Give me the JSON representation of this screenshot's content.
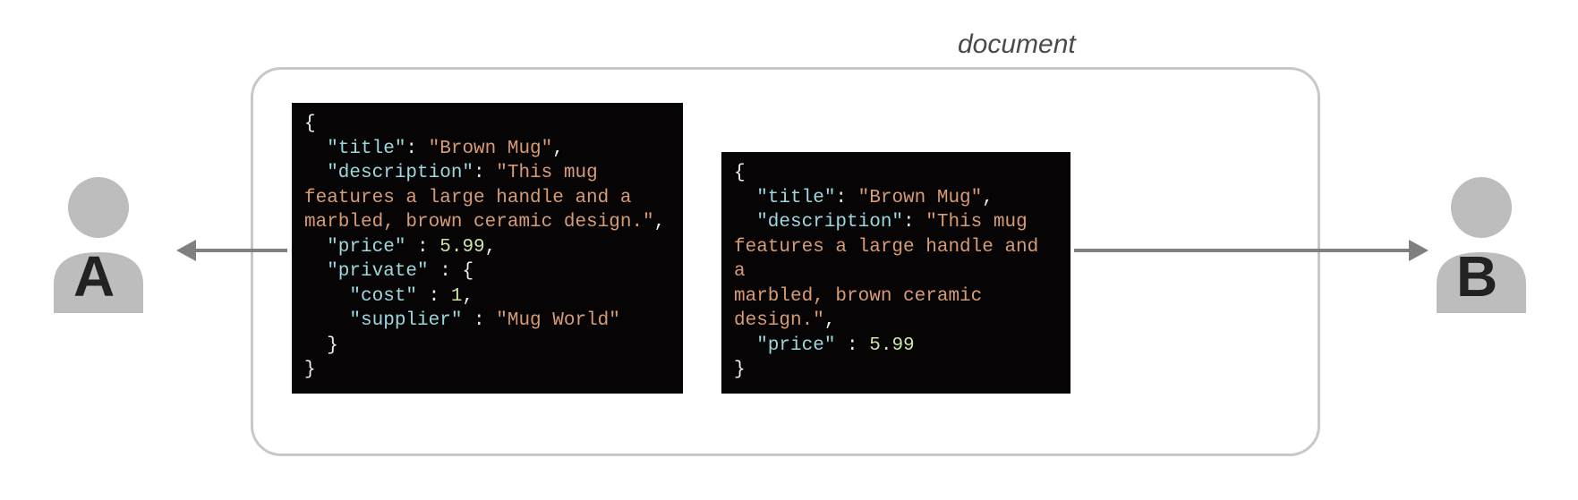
{
  "label": {
    "document": "document"
  },
  "users": {
    "a": "A",
    "b": "B"
  },
  "json": {
    "k_title": "\"title\"",
    "k_description": "\"description\"",
    "k_price": "\"price\"",
    "k_private": "\"private\"",
    "k_cost": "\"cost\"",
    "k_supplier": "\"supplier\"",
    "v_title": "\"Brown Mug\"",
    "desc_l1": "\"This mug",
    "desc_l2": "features a large handle and a",
    "desc_l3": "marbled, brown ceramic design.\"",
    "v_price": "5.99",
    "v_cost": "1",
    "v_supplier": "\"Mug World\"",
    "brace_open": "{",
    "brace_close": "}",
    "colon_sp": ": ",
    "sp_colon_sp": " : ",
    "comma": ","
  }
}
